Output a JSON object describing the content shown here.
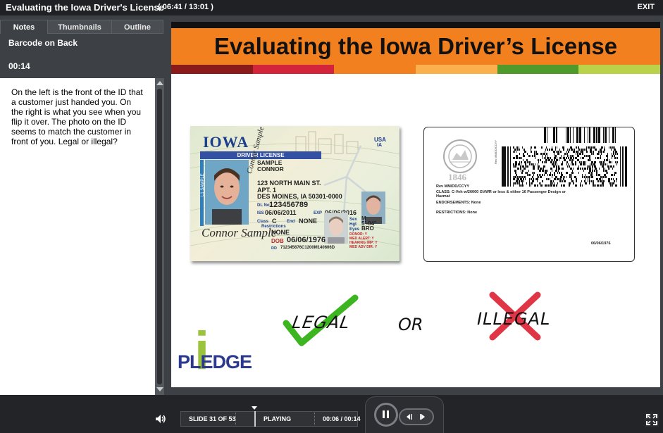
{
  "window": {
    "course_title": "Evaluating the Iowa Driver's License",
    "timer": "( 06:41 / 13:01 )",
    "exit_label": "EXIT"
  },
  "sidebar": {
    "tabs": [
      {
        "label": "Notes",
        "active": true
      },
      {
        "label": "Thumbnails",
        "active": false
      },
      {
        "label": "Outline",
        "active": false
      }
    ],
    "slide_name": "Barcode on Back",
    "slide_duration": "00:14",
    "notes_text": "On the left is the front of the ID that a customer just handed you.  On the right is what you see when you flip it over.  The photo on the ID seems to match the customer in front of you. Legal or illegal?"
  },
  "slide": {
    "title": "Evaluating the Iowa Driver’s License",
    "stripe_colors": [
      "#8b1a1a",
      "#d2243b",
      "#f3801f",
      "#f9b04d",
      "#4f9a2b",
      "#b9d249"
    ],
    "banner_color": "#f3801f",
    "id_front": {
      "state": "IOWA",
      "usa_label": "USA",
      "state_abbr": "IA",
      "header": "DRIVER LICENSE",
      "last_name": "SAMPLE",
      "first_name": "CONNOR",
      "address1": "123 NORTH MAIN ST.",
      "address2": "APT. 1",
      "address3": "DES MOINES, IA 50301-0000",
      "dl_label": "DL No.",
      "dl_number": "123456789",
      "iss_label": "ISS",
      "iss_date": "06/06/2011",
      "exp_label": "EXP",
      "exp_date": "06/06/2016",
      "class_label": "Class",
      "class_value": "C",
      "end_label": "End",
      "end_value": "NONE",
      "restrictions_label": "Restrictions",
      "restrictions_value": "NONE",
      "sex_label": "Sex",
      "sex_value": "M",
      "hgt_label": "Hgt",
      "hgt_value": "5'-04\"",
      "eyes_label": "Eyes",
      "eyes_value": "BRO",
      "donor": "DONOR: Y",
      "med_alert": "MED ALERT: Y",
      "hearing_imp": "HEARING IMP: Y",
      "med_adv_dir": "MED ADV DIR: Y",
      "dob_label": "DOB",
      "dob_value": "06/06/1976",
      "dd_label": "DD",
      "dd_value": "712345676C1200M140606D",
      "side_label": "L1 SAMPLE",
      "signature": "Connor Sample"
    },
    "id_back": {
      "seal_year": "1846",
      "rev_line": "Rev MM/DD/CCYY",
      "class_line": "CLASS: C-Veh w/26000 GVWR or less & either 16 Passenger Design or Hazmat",
      "endorsements_line": "ENDORSEMENTS: None",
      "restrictions_line": "RESTRICTIONS: None",
      "date": "06/06/1976"
    },
    "options": {
      "legal": "LEGAL",
      "or": "OR",
      "illegal": "ILLEGAL",
      "check_color": "#3cb521",
      "x_color": "#e03545"
    },
    "logo": {
      "i_letter": "i",
      "pledge": "PLEDGE",
      "i_color": "#9bc33c",
      "pledge_color": "#2b3a8f"
    }
  },
  "player": {
    "slide_count": "SLIDE 31 OF 53",
    "state": "PLAYING",
    "time": "00:06 / 00:14"
  }
}
